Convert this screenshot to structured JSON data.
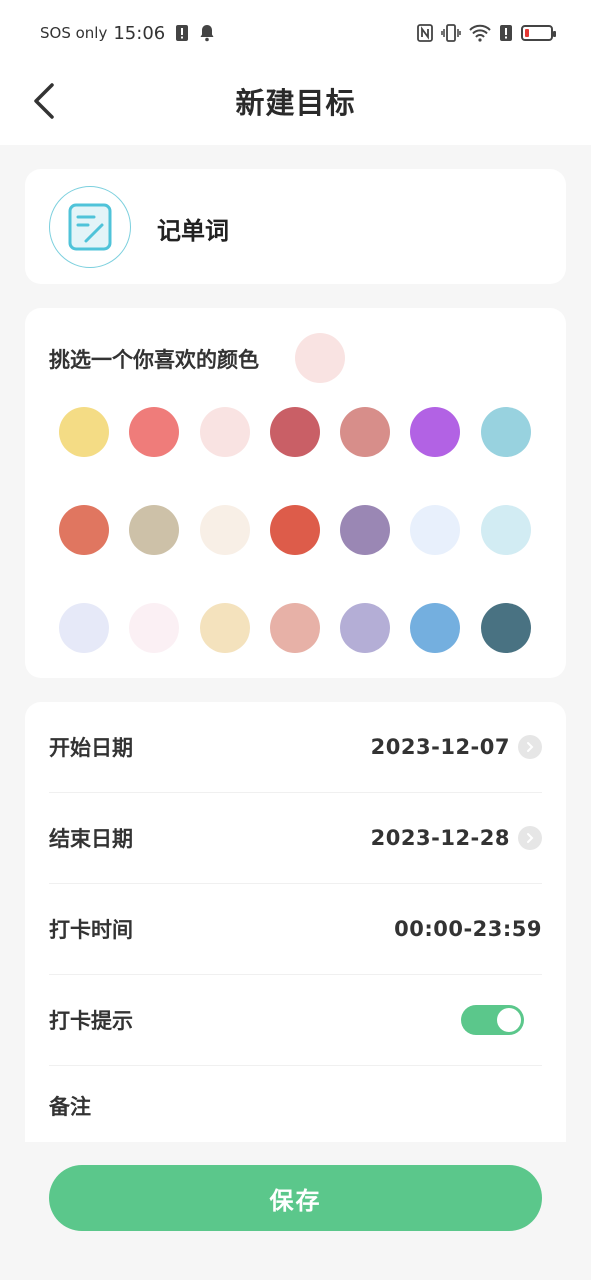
{
  "status_bar": {
    "carrier": "SOS only",
    "time": "15:06"
  },
  "header": {
    "title": "新建目标"
  },
  "goal": {
    "name": "记单词",
    "icon": "note-edit-icon",
    "icon_color": "#4fc3d9"
  },
  "color_picker": {
    "label": "挑选一个你喜欢的颜色",
    "selected_color": "#f9e3e2",
    "swatches": [
      "#f4dc85",
      "#ef7c7a",
      "#f9e3e2",
      "#c95f66",
      "#d78e8a",
      "#b262e4",
      "#98d2df",
      "#e07660",
      "#cdc1a8",
      "#f8efe6",
      "#dd5c4a",
      "#9a87b4",
      "#e8f0fc",
      "#d2ecf3",
      "#e6e9f8",
      "#fbf0f4",
      "#f4e2bd",
      "#e7b1a7",
      "#b4aed6",
      "#74afdf",
      "#497282"
    ]
  },
  "settings": {
    "start_date_label": "开始日期",
    "start_date": "2023-12-07",
    "end_date_label": "结束日期",
    "end_date": "2023-12-28",
    "checkin_time_label": "打卡时间",
    "checkin_time": "00:00-23:59",
    "reminder_label": "打卡提示",
    "reminder_on": true,
    "note_label": "备注"
  },
  "save_label": "保存",
  "colors": {
    "accent": "#5bc78b"
  }
}
